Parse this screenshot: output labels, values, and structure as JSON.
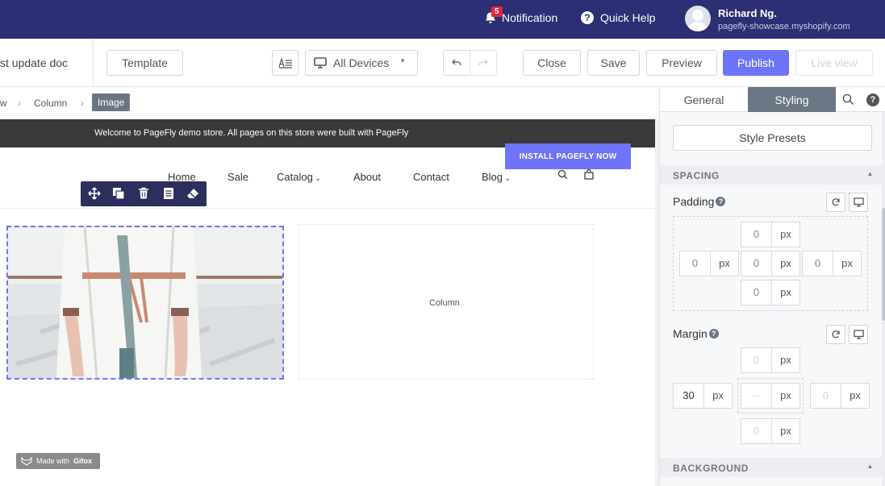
{
  "topbar": {
    "notification_count": "5",
    "notification_label": "Notification",
    "help_label": "Quick Help",
    "user_name": "Richard Ng.",
    "user_store": "pagefly-showcase.myshopify.com"
  },
  "toolbar": {
    "doc_title": "st update doc",
    "template": "Template",
    "devices": "All Devices",
    "close": "Close",
    "save": "Save",
    "preview": "Preview",
    "publish": "Publish",
    "live_view": "Live view"
  },
  "breadcrumb": {
    "item1": "w",
    "item2": "Column",
    "active": "Image"
  },
  "canvas": {
    "announcement": "Welcome to PageFly demo store. All pages on this store were built with PageFly",
    "install_cta": "INSTALL PAGEFLY NOW",
    "nav": [
      "Home",
      "Sale",
      "Catalog",
      "About",
      "Contact",
      "Blog"
    ],
    "column_placeholder": "Column",
    "gifox_prefix": "Made with",
    "gifox_brand": "Gifox"
  },
  "panel": {
    "tab_general": "General",
    "tab_styling": "Styling",
    "style_presets": "Style Presets",
    "spacing_header": "SPACING",
    "padding_label": "Padding",
    "margin_label": "Margin",
    "background_header": "BACKGROUND",
    "unit": "px",
    "padding": {
      "top": "0",
      "left": "0",
      "center": "0",
      "right": "0",
      "bottom": "0"
    },
    "margin": {
      "top": "0",
      "left": "30",
      "center": "--",
      "right": "0",
      "bottom": "0"
    }
  },
  "colors": {
    "topbar": "#2c2f73",
    "accent": "#6e74f7",
    "active_tab": "#6b7684"
  }
}
